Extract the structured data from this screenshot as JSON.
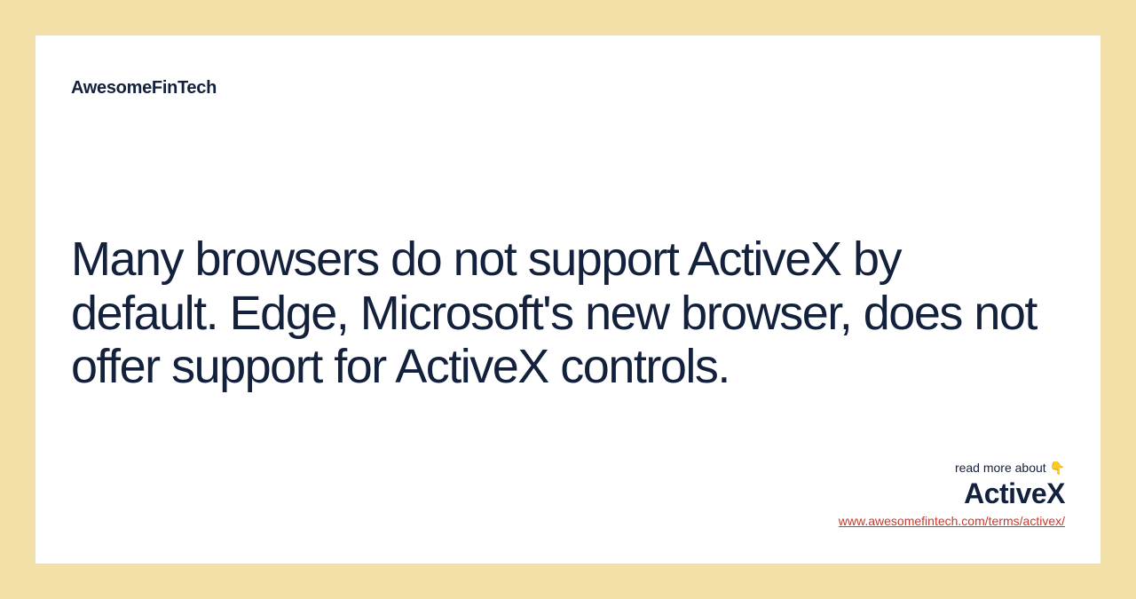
{
  "brand": "AwesomeFinTech",
  "quote": "Many browsers do not support ActiveX by default. Edge, Microsoft's new browser, does not offer support for ActiveX controls.",
  "footer": {
    "readMore": "read more about 👇",
    "termName": "ActiveX",
    "termLink": "www.awesomefintech.com/terms/activex/"
  }
}
